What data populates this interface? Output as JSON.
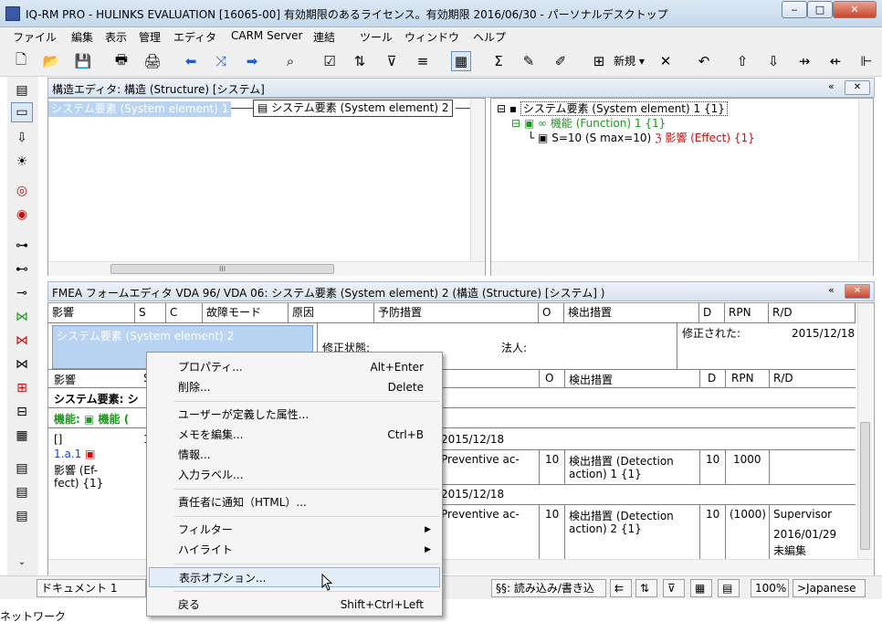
{
  "window": {
    "title": "IQ-RM PRO - HULINKS EVALUATION [16065-00] 有効期限のあるライセンス。有効期限 2016/06/30 - パーソナルデスクトップ",
    "minimize": "‒",
    "maximize": "□",
    "close": "✕"
  },
  "menu": [
    "ファイル",
    "編集",
    "表示",
    "管理",
    "エディタ",
    "CARM Server",
    "連結",
    "ツール",
    "ウィンドウ",
    "ヘルプ"
  ],
  "toolbar": {
    "new_label": "新規",
    "new_arrow": "▾"
  },
  "structure_editor": {
    "title": "構造エディタ: 構造 (Structure) [システム]",
    "collapse": "«",
    "close": "✕",
    "node1": "システム要素 (System element) 1",
    "node2": "システム要素 (System element) 2",
    "tree": {
      "root": "システム要素 (System element) 1 {1}",
      "function": "機能 (Function) 1 {1}",
      "effect_prefix": "S=10 (S max=10)",
      "effect": "影響 (Effect) {1}"
    },
    "scroll_thumb": "III"
  },
  "fmea_editor": {
    "title": "FMEA フォームエディタ VDA 96/ VDA 06: システム要素 (System element) 2 (構造 (Structure) [システム] )",
    "collapse": "«",
    "close": "✕",
    "headers": [
      "影響",
      "S",
      "C",
      "故障モード",
      "原因",
      "予防措置",
      "O",
      "検出措置",
      "D",
      "RPN",
      "R/D"
    ],
    "selected_element": "システム要素 (System element) 2",
    "status_label": "修正状態:",
    "legal_label": "法人:",
    "modified_label": "修正された:",
    "modified_date": "2015/12/18",
    "sub_headers": [
      "影響",
      "S",
      "O",
      "検出措置",
      "D",
      "RPN",
      "R/D"
    ],
    "system_row": "システム要素: シ",
    "function_row": "機能:",
    "function_row2": "機能 (",
    "effect_cell": {
      "bracket": "[]",
      "id": "1.a.1",
      "line1": "影響 (Ef-",
      "line2": "fect) {1}",
      "s_value": "1"
    },
    "row1": {
      "date": "2015/12/18",
      "prevent": "Preventive ac-",
      "o": "10",
      "detect": "検出措置 (Detection",
      "detect2": "action) 1 {1}",
      "d": "10",
      "rpn": "1000"
    },
    "row2": {
      "date": "2015/12/18",
      "prevent": "Preventive ac-",
      "o": "10",
      "detect": "検出措置 (Detection",
      "detect2": "action) 2 {1}",
      "d": "10",
      "rpn": "(1000)",
      "rd": "Supervisor",
      "rd_date": "2016/01/29",
      "rd_status": "未編集"
    }
  },
  "context_menu": [
    {
      "label": "プロパティ...",
      "shortcut": "Alt+Enter"
    },
    {
      "label": "削除...",
      "shortcut": "Delete"
    },
    {
      "label": "ユーザーが定義した属性..."
    },
    {
      "label": "メモを編集...",
      "shortcut": "Ctrl+B"
    },
    {
      "label": "情報..."
    },
    {
      "label": "入力ラベル..."
    },
    {
      "label": "責任者に通知（HTML）..."
    },
    {
      "label": "フィルター",
      "submenu": "▶"
    },
    {
      "label": "ハイライト",
      "submenu": "▶"
    },
    {
      "label": "表示オプション..."
    },
    {
      "label": "戻る",
      "shortcut": "Shift+Ctrl+Left"
    }
  ],
  "statusbar": {
    "document": "ドキュメント 1",
    "mode": "§§: 読み込み/書き込",
    "zoom": "100%",
    "language": ">Japanese"
  },
  "background_text": "ネットワーク",
  "colors": {
    "function_green": "#1a9a1a",
    "effect_red": "#cc1010",
    "selection_blue": "#b8d4f2",
    "menu_highlight": "#e4eef9"
  }
}
